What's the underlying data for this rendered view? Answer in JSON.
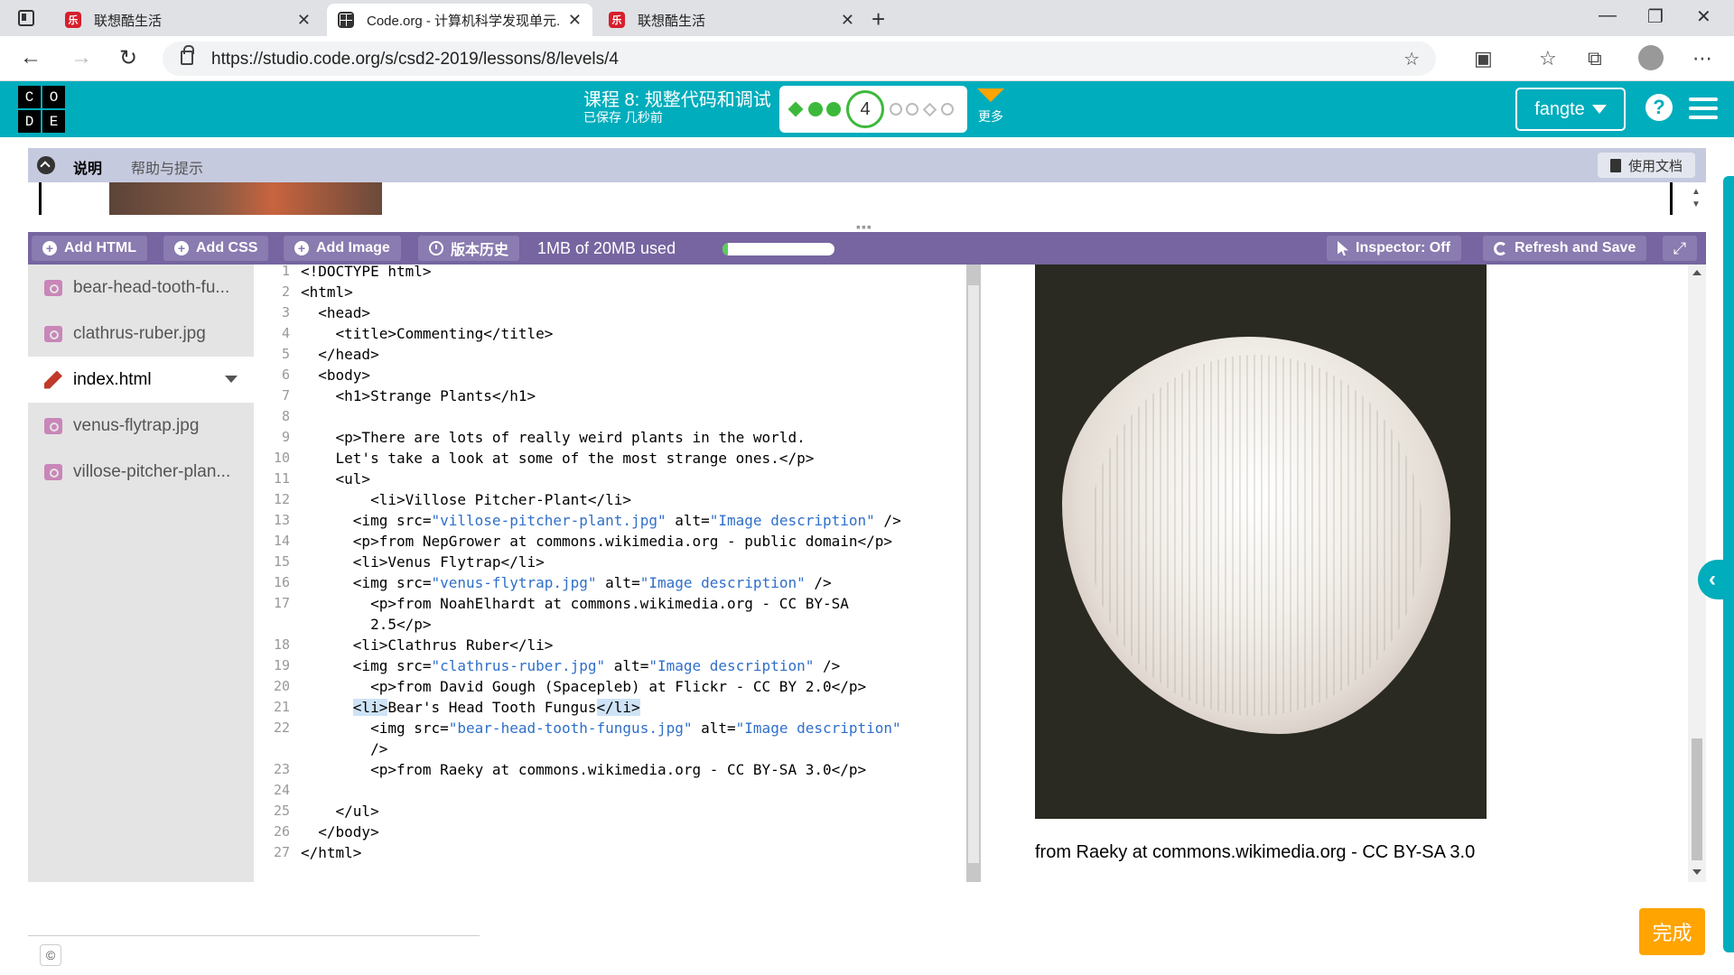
{
  "browser": {
    "tabs": [
      {
        "title": "联想酷生活",
        "active": false
      },
      {
        "title": "Code.org - 计算机科学发现单元...",
        "active": true
      },
      {
        "title": "联想酷生活",
        "active": false
      }
    ],
    "url": "https://studio.code.org/s/csd2-2019/lessons/8/levels/4"
  },
  "header": {
    "logo_letters": [
      "C",
      "O",
      "D",
      "E"
    ],
    "lesson_title": "课程 8: 规整代码和调试",
    "saved_status": "已保存 几秒前",
    "current_level": "4",
    "more_label": "更多",
    "user_name": "fangte",
    "help_glyph": "?"
  },
  "instructions": {
    "tabs": [
      "说明",
      "帮助与提示"
    ],
    "docs_label": "使用文档"
  },
  "toolbar": {
    "add_html": "Add HTML",
    "add_css": "Add CSS",
    "add_image": "Add Image",
    "version_history": "版本历史",
    "usage": "1MB of 20MB used",
    "usage_fraction": 0.05,
    "inspector": "Inspector: Off",
    "refresh_save": "Refresh and Save"
  },
  "files": [
    {
      "name": "bear-head-tooth-fu...",
      "type": "image"
    },
    {
      "name": "clathrus-ruber.jpg",
      "type": "image"
    },
    {
      "name": "index.html",
      "type": "html",
      "active": true
    },
    {
      "name": "venus-flytrap.jpg",
      "type": "image"
    },
    {
      "name": "villose-pitcher-plan...",
      "type": "image"
    }
  ],
  "code_lines": [
    {
      "n": "1",
      "text": "<!DOCTYPE html>"
    },
    {
      "n": "2",
      "text": "<html>"
    },
    {
      "n": "3",
      "text": "  <head>"
    },
    {
      "n": "4",
      "text": "    <title>Commenting</title>"
    },
    {
      "n": "5",
      "text": "  </head>"
    },
    {
      "n": "6",
      "text": "  <body>"
    },
    {
      "n": "7",
      "text": "    <h1>Strange Plants</h1>"
    },
    {
      "n": "8",
      "text": ""
    },
    {
      "n": "9",
      "text": "    <p>There are lots of really weird plants in the world."
    },
    {
      "n": "10",
      "text": "    Let's take a look at some of the most strange ones.</p>"
    },
    {
      "n": "11",
      "text": "    <ul>"
    },
    {
      "n": "12",
      "text": "        <li>Villose Pitcher-Plant</li>"
    },
    {
      "n": "13",
      "text": "      <img src=\"villose-pitcher-plant.jpg\" alt=\"Image description\" />"
    },
    {
      "n": "14",
      "text": "      <p>from NepGrower at commons.wikimedia.org - public domain</p>"
    },
    {
      "n": "15",
      "text": "      <li>Venus Flytrap</li>"
    },
    {
      "n": "16",
      "text": "      <img src=\"venus-flytrap.jpg\" alt=\"Image description\" />"
    },
    {
      "n": "17",
      "text": "        <p>from NoahElhardt at commons.wikimedia.org - CC BY-SA"
    },
    {
      "n": "",
      "text": "        2.5</p>"
    },
    {
      "n": "18",
      "text": "      <li>Clathrus Ruber</li>"
    },
    {
      "n": "19",
      "text": "      <img src=\"clathrus-ruber.jpg\" alt=\"Image description\" />"
    },
    {
      "n": "20",
      "text": "        <p>from David Gough (Spacepleb) at Flickr - CC BY 2.0</p>"
    },
    {
      "n": "21",
      "text": "      <li>Bear's Head Tooth Fungus</li>"
    },
    {
      "n": "22",
      "text": "        <img src=\"bear-head-tooth-fungus.jpg\" alt=\"Image description\""
    },
    {
      "n": "",
      "text": "        />"
    },
    {
      "n": "23",
      "text": "        <p>from Raeky at commons.wikimedia.org - CC BY-SA 3.0</p>"
    },
    {
      "n": "24",
      "text": ""
    },
    {
      "n": "25",
      "text": "    </ul>"
    },
    {
      "n": "26",
      "text": "  </body>"
    },
    {
      "n": "27",
      "text": "</html>"
    }
  ],
  "preview": {
    "caption": "from Raeky at commons.wikimedia.org - CC BY-SA 3.0"
  },
  "footer": {
    "finish_label": "完成",
    "copyright_glyph": "©"
  },
  "colors": {
    "header": "#00adbc",
    "toolbar": "#7665a0",
    "finish": "#ffa400",
    "progress": "#3cb93c",
    "code_string": "#2f6fc9"
  }
}
